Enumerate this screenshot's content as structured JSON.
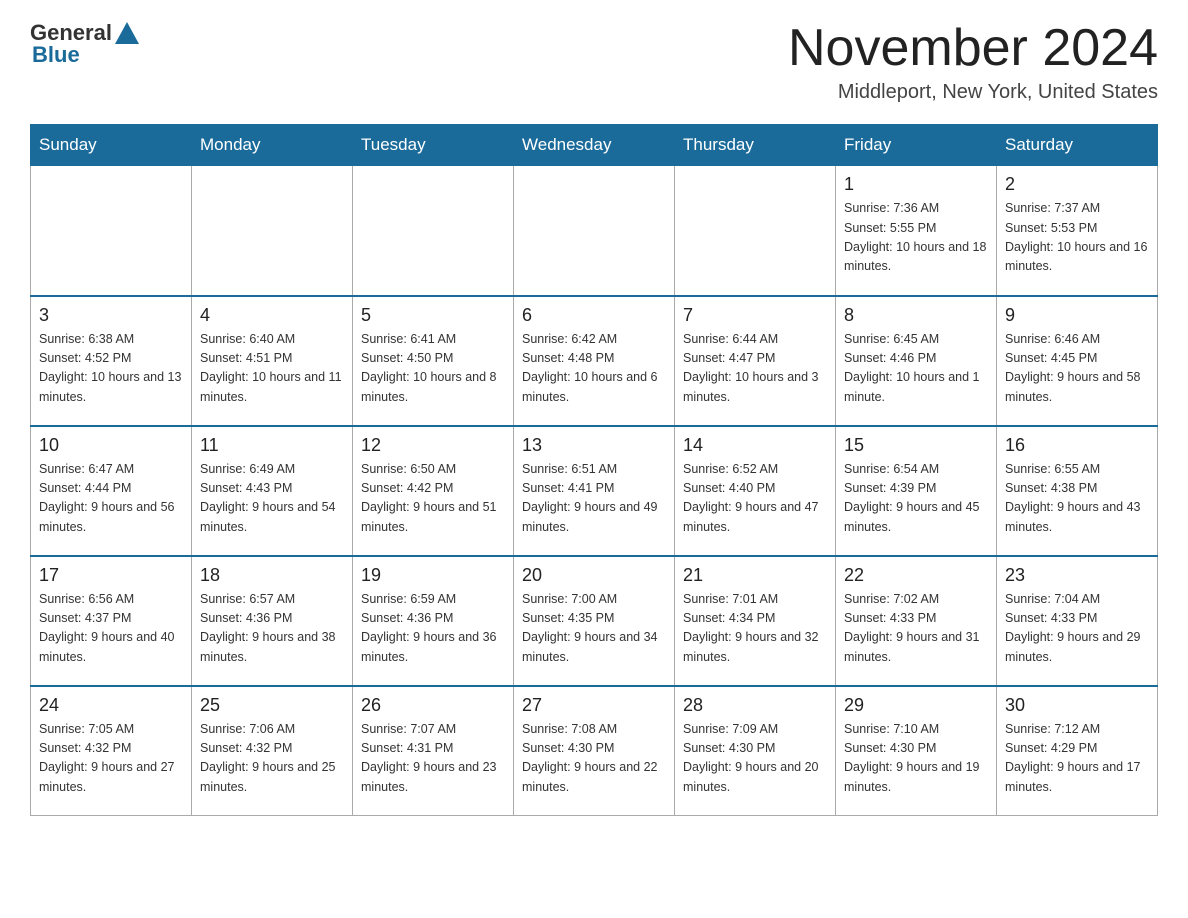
{
  "header": {
    "logo_general": "General",
    "logo_blue": "Blue",
    "month_title": "November 2024",
    "location": "Middleport, New York, United States"
  },
  "weekdays": [
    "Sunday",
    "Monday",
    "Tuesday",
    "Wednesday",
    "Thursday",
    "Friday",
    "Saturday"
  ],
  "weeks": [
    [
      {
        "day": "",
        "sunrise": "",
        "sunset": "",
        "daylight": ""
      },
      {
        "day": "",
        "sunrise": "",
        "sunset": "",
        "daylight": ""
      },
      {
        "day": "",
        "sunrise": "",
        "sunset": "",
        "daylight": ""
      },
      {
        "day": "",
        "sunrise": "",
        "sunset": "",
        "daylight": ""
      },
      {
        "day": "",
        "sunrise": "",
        "sunset": "",
        "daylight": ""
      },
      {
        "day": "1",
        "sunrise": "Sunrise: 7:36 AM",
        "sunset": "Sunset: 5:55 PM",
        "daylight": "Daylight: 10 hours and 18 minutes."
      },
      {
        "day": "2",
        "sunrise": "Sunrise: 7:37 AM",
        "sunset": "Sunset: 5:53 PM",
        "daylight": "Daylight: 10 hours and 16 minutes."
      }
    ],
    [
      {
        "day": "3",
        "sunrise": "Sunrise: 6:38 AM",
        "sunset": "Sunset: 4:52 PM",
        "daylight": "Daylight: 10 hours and 13 minutes."
      },
      {
        "day": "4",
        "sunrise": "Sunrise: 6:40 AM",
        "sunset": "Sunset: 4:51 PM",
        "daylight": "Daylight: 10 hours and 11 minutes."
      },
      {
        "day": "5",
        "sunrise": "Sunrise: 6:41 AM",
        "sunset": "Sunset: 4:50 PM",
        "daylight": "Daylight: 10 hours and 8 minutes."
      },
      {
        "day": "6",
        "sunrise": "Sunrise: 6:42 AM",
        "sunset": "Sunset: 4:48 PM",
        "daylight": "Daylight: 10 hours and 6 minutes."
      },
      {
        "day": "7",
        "sunrise": "Sunrise: 6:44 AM",
        "sunset": "Sunset: 4:47 PM",
        "daylight": "Daylight: 10 hours and 3 minutes."
      },
      {
        "day": "8",
        "sunrise": "Sunrise: 6:45 AM",
        "sunset": "Sunset: 4:46 PM",
        "daylight": "Daylight: 10 hours and 1 minute."
      },
      {
        "day": "9",
        "sunrise": "Sunrise: 6:46 AM",
        "sunset": "Sunset: 4:45 PM",
        "daylight": "Daylight: 9 hours and 58 minutes."
      }
    ],
    [
      {
        "day": "10",
        "sunrise": "Sunrise: 6:47 AM",
        "sunset": "Sunset: 4:44 PM",
        "daylight": "Daylight: 9 hours and 56 minutes."
      },
      {
        "day": "11",
        "sunrise": "Sunrise: 6:49 AM",
        "sunset": "Sunset: 4:43 PM",
        "daylight": "Daylight: 9 hours and 54 minutes."
      },
      {
        "day": "12",
        "sunrise": "Sunrise: 6:50 AM",
        "sunset": "Sunset: 4:42 PM",
        "daylight": "Daylight: 9 hours and 51 minutes."
      },
      {
        "day": "13",
        "sunrise": "Sunrise: 6:51 AM",
        "sunset": "Sunset: 4:41 PM",
        "daylight": "Daylight: 9 hours and 49 minutes."
      },
      {
        "day": "14",
        "sunrise": "Sunrise: 6:52 AM",
        "sunset": "Sunset: 4:40 PM",
        "daylight": "Daylight: 9 hours and 47 minutes."
      },
      {
        "day": "15",
        "sunrise": "Sunrise: 6:54 AM",
        "sunset": "Sunset: 4:39 PM",
        "daylight": "Daylight: 9 hours and 45 minutes."
      },
      {
        "day": "16",
        "sunrise": "Sunrise: 6:55 AM",
        "sunset": "Sunset: 4:38 PM",
        "daylight": "Daylight: 9 hours and 43 minutes."
      }
    ],
    [
      {
        "day": "17",
        "sunrise": "Sunrise: 6:56 AM",
        "sunset": "Sunset: 4:37 PM",
        "daylight": "Daylight: 9 hours and 40 minutes."
      },
      {
        "day": "18",
        "sunrise": "Sunrise: 6:57 AM",
        "sunset": "Sunset: 4:36 PM",
        "daylight": "Daylight: 9 hours and 38 minutes."
      },
      {
        "day": "19",
        "sunrise": "Sunrise: 6:59 AM",
        "sunset": "Sunset: 4:36 PM",
        "daylight": "Daylight: 9 hours and 36 minutes."
      },
      {
        "day": "20",
        "sunrise": "Sunrise: 7:00 AM",
        "sunset": "Sunset: 4:35 PM",
        "daylight": "Daylight: 9 hours and 34 minutes."
      },
      {
        "day": "21",
        "sunrise": "Sunrise: 7:01 AM",
        "sunset": "Sunset: 4:34 PM",
        "daylight": "Daylight: 9 hours and 32 minutes."
      },
      {
        "day": "22",
        "sunrise": "Sunrise: 7:02 AM",
        "sunset": "Sunset: 4:33 PM",
        "daylight": "Daylight: 9 hours and 31 minutes."
      },
      {
        "day": "23",
        "sunrise": "Sunrise: 7:04 AM",
        "sunset": "Sunset: 4:33 PM",
        "daylight": "Daylight: 9 hours and 29 minutes."
      }
    ],
    [
      {
        "day": "24",
        "sunrise": "Sunrise: 7:05 AM",
        "sunset": "Sunset: 4:32 PM",
        "daylight": "Daylight: 9 hours and 27 minutes."
      },
      {
        "day": "25",
        "sunrise": "Sunrise: 7:06 AM",
        "sunset": "Sunset: 4:32 PM",
        "daylight": "Daylight: 9 hours and 25 minutes."
      },
      {
        "day": "26",
        "sunrise": "Sunrise: 7:07 AM",
        "sunset": "Sunset: 4:31 PM",
        "daylight": "Daylight: 9 hours and 23 minutes."
      },
      {
        "day": "27",
        "sunrise": "Sunrise: 7:08 AM",
        "sunset": "Sunset: 4:30 PM",
        "daylight": "Daylight: 9 hours and 22 minutes."
      },
      {
        "day": "28",
        "sunrise": "Sunrise: 7:09 AM",
        "sunset": "Sunset: 4:30 PM",
        "daylight": "Daylight: 9 hours and 20 minutes."
      },
      {
        "day": "29",
        "sunrise": "Sunrise: 7:10 AM",
        "sunset": "Sunset: 4:30 PM",
        "daylight": "Daylight: 9 hours and 19 minutes."
      },
      {
        "day": "30",
        "sunrise": "Sunrise: 7:12 AM",
        "sunset": "Sunset: 4:29 PM",
        "daylight": "Daylight: 9 hours and 17 minutes."
      }
    ]
  ]
}
